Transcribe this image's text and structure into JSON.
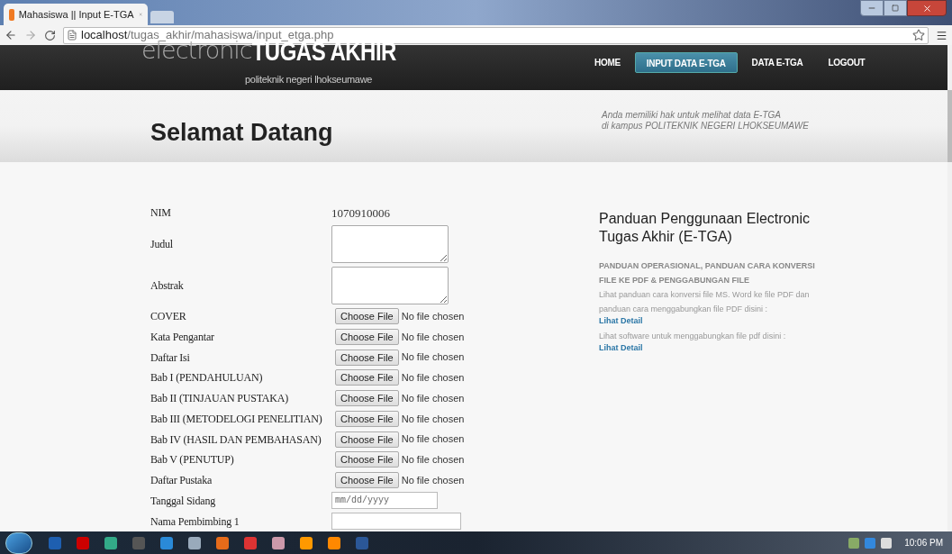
{
  "browser": {
    "tab_title": "Mahasiswa || Input E-TGA",
    "url_host": "localhost",
    "url_path": "/tugas_akhir/mahasiswa/input_etga.php"
  },
  "header": {
    "logo_light": "electronic",
    "logo_bold": "TUGAS AKHIR",
    "subtitle": "politeknik negeri lhokseumawe",
    "nav": [
      {
        "label": "HOME",
        "selected": false
      },
      {
        "label": "INPUT DATA E-TGA",
        "selected": true
      },
      {
        "label": "DATA E-TGA",
        "selected": false
      },
      {
        "label": "LOGOUT",
        "selected": false
      }
    ]
  },
  "banner": {
    "title": "Selamat Datang",
    "note_lines": [
      "Anda memiliki hak untuk melihat data E-TGA",
      "di kampus POLITEKNIK NEGERI LHOKSEUMAWE"
    ]
  },
  "form": {
    "rows": [
      {
        "kind": "text",
        "label": "NIM",
        "value": "1070910006"
      },
      {
        "kind": "textarea",
        "label": "Judul"
      },
      {
        "kind": "textarea",
        "label": "Abstrak"
      },
      {
        "kind": "file",
        "label": "COVER",
        "button": "Choose File",
        "status": "No file chosen"
      },
      {
        "kind": "file",
        "label": "Kata Pengantar",
        "button": "Choose File",
        "status": "No file chosen"
      },
      {
        "kind": "file",
        "label": "Daftar Isi",
        "button": "Choose File",
        "status": "No file chosen"
      },
      {
        "kind": "file",
        "label": "Bab I (PENDAHULUAN)",
        "button": "Choose File",
        "status": "No file chosen"
      },
      {
        "kind": "file",
        "label": "Bab II (TINJAUAN PUSTAKA)",
        "button": "Choose File",
        "status": "No file chosen"
      },
      {
        "kind": "file",
        "label": "Bab III (METODELOGI PENELITIAN)",
        "button": "Choose File",
        "status": "No file chosen"
      },
      {
        "kind": "file",
        "label": "Bab IV (HASIL DAN PEMBAHASAN)",
        "button": "Choose File",
        "status": "No file chosen"
      },
      {
        "kind": "file",
        "label": "Bab V (PENUTUP)",
        "button": "Choose File",
        "status": "No file chosen"
      },
      {
        "kind": "file",
        "label": "Daftar Pustaka",
        "button": "Choose File",
        "status": "No file chosen"
      },
      {
        "kind": "date",
        "label": "Tanggal Sidang",
        "placeholder": "mm/dd/yyyy"
      },
      {
        "kind": "input",
        "label": "Nama Pembimbing 1"
      }
    ]
  },
  "guide": {
    "title": "Panduan Penggunaan Electronic Tugas Akhir (E-TGA)",
    "heading": "PANDUAN OPERASIONAL, PANDUAN CARA KONVERSI FILE KE PDF & PENGGABUNGAN FILE",
    "paragraphs": [
      {
        "text": "Lihat panduan cara konversi file MS. Word ke file PDF dan panduan cara menggabungkan file PDF disini :",
        "link": "Lihat Detail"
      },
      {
        "text": "Lihat software untuk menggabungkan file pdf disini :",
        "link": "Lihat Detail"
      }
    ]
  },
  "taskbar": {
    "clock": "10:06 PM"
  }
}
